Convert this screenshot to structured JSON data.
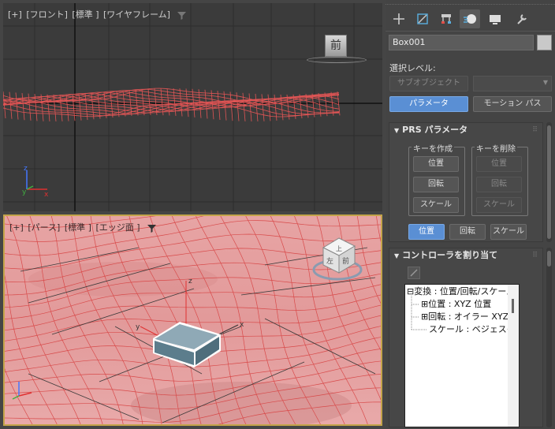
{
  "viewport_top": {
    "label_parts": [
      "[+]",
      "[フロント]",
      "[標準 ]",
      "[ワイヤフレーム]"
    ],
    "viewcube_face": "前"
  },
  "viewport_bottom": {
    "label_parts": [
      "[+]",
      "[パース]",
      "[標準 ]",
      "[エッジ面 ]"
    ],
    "axis_x": "x",
    "axis_y": "y",
    "axis_z": "z"
  },
  "panel": {
    "object_name": "Box001",
    "selection_level_label": "選択レベル:",
    "sub_object_button": "サブオブジェクト",
    "parameters_button": "パラメータ",
    "motion_path_button": "モーション パス",
    "prs_rollout": {
      "title": "PRS パラメータ",
      "create_key_group": "キーを作成",
      "delete_key_group": "キーを削除",
      "create_position": "位置",
      "create_rotation": "回転",
      "create_scale": "スケール",
      "delete_position": "位置",
      "delete_rotation": "回転",
      "delete_scale": "スケール",
      "mode_position": "位置",
      "mode_rotation": "回転",
      "mode_scale": "スケール"
    },
    "controller_rollout": {
      "title": "コントローラを割り当て",
      "tree": [
        "⊟変換 : 位置/回転/スケール",
        "⊞位置 : XYZ 位置",
        "⊞回転 : オイラー XYZ",
        "スケール : ベジェスケール"
      ]
    }
  },
  "colors": {
    "accent_blue": "#5a8fd4",
    "viewport_active_border": "#c4a44a",
    "wire_red": "#e05555"
  }
}
